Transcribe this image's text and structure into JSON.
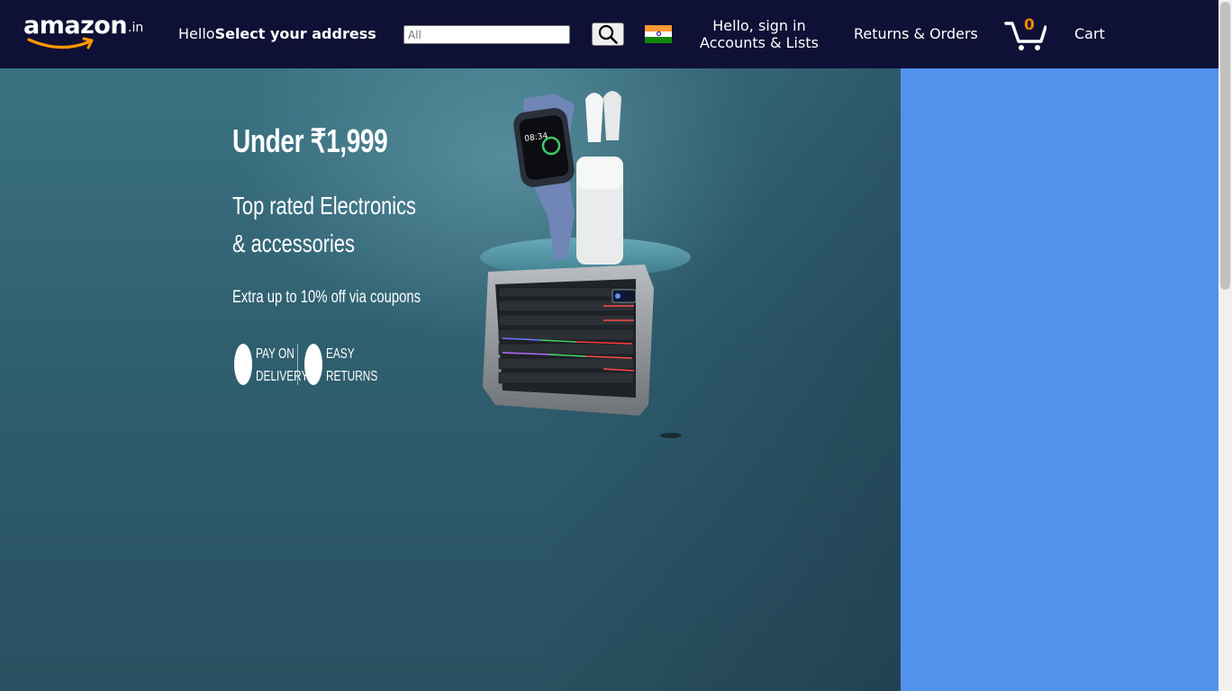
{
  "colors": {
    "nav_background": "#0f1035",
    "side_panel": "#5291ec",
    "cart_count": "#f08804",
    "logo_smile": "#ff9900"
  },
  "header": {
    "logo_text": "amazon",
    "logo_tld": ".in",
    "address_hello": "Hello",
    "address_select": "Select your address",
    "search": {
      "placeholder": "All",
      "value": ""
    },
    "search_icon": "search-icon",
    "country_flag": "india-flag-icon",
    "account_line1": "Hello, sign in",
    "account_line2": "Accounts & Lists",
    "returns_orders": "Returns & Orders",
    "cart_icon": "cart-icon",
    "cart_count": "0",
    "cart_label": "Cart"
  },
  "hero": {
    "headline": "Under ₹1,999",
    "subline1": "Top rated Electronics",
    "subline2": "& accessories",
    "offer": "Extra up to 10% off via coupons",
    "badge1_line1": "PAY ON",
    "badge1_line2": "DELIVERY",
    "badge2_line1": "EASY",
    "badge2_line2": "RETURNS",
    "product_image": "smartwatch, earbuds and rgb keyboard"
  }
}
